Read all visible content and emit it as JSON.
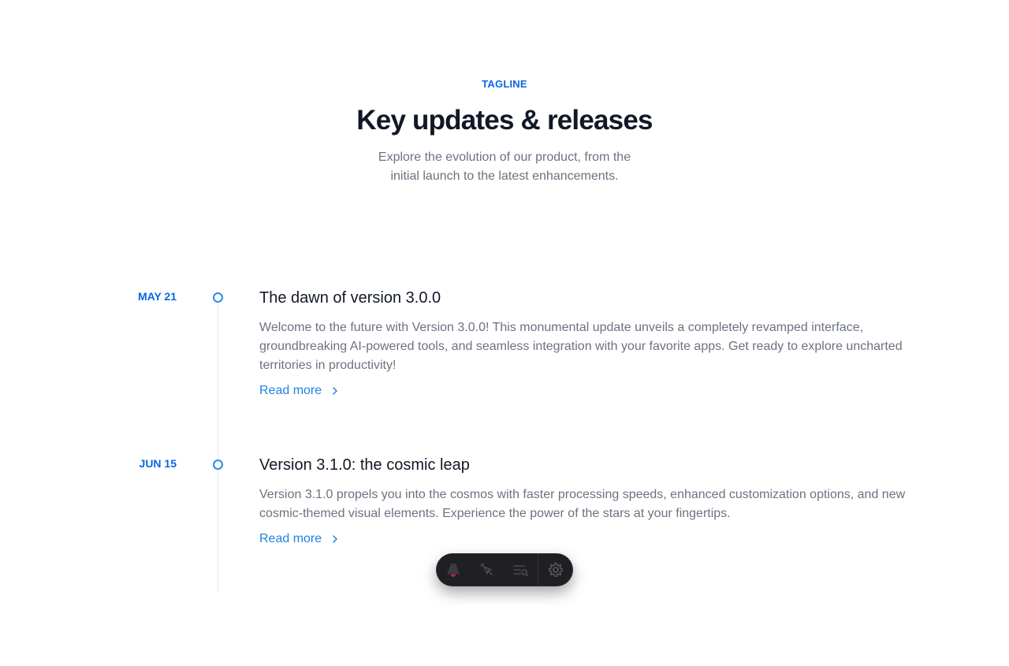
{
  "header": {
    "tagline": "TAGLINE",
    "title": "Key updates & releases",
    "subtitle": "Explore the evolution of our product, from the initial launch to the latest enhancements."
  },
  "timeline": [
    {
      "date": "MAY 21",
      "title": "The dawn of version 3.0.0",
      "body": "Welcome to the future with Version 3.0.0! This monumental update unveils a completely revamped interface, groundbreaking AI-powered tools, and seamless integration with your favorite apps. Get ready to explore uncharted territories in productivity!",
      "link": "Read more"
    },
    {
      "date": "JUN 15",
      "title": "Version 3.1.0: the cosmic leap",
      "body": "Version 3.1.0 propels you into the cosmos with faster processing speeds, enhanced customization options, and new cosmic-themed visual elements. Experience the power of the stars at your fingertips.",
      "link": "Read more"
    }
  ],
  "toolbar": {
    "icons": [
      "astro-logo-icon",
      "inspect-cursor-icon",
      "audit-list-icon",
      "settings-gear-icon"
    ]
  },
  "colors": {
    "accent": "#0a66e0",
    "link": "#1f83e0",
    "muted_text": "#6b7280",
    "heading": "#111827",
    "toolbar_bg": "#1f1f24"
  }
}
